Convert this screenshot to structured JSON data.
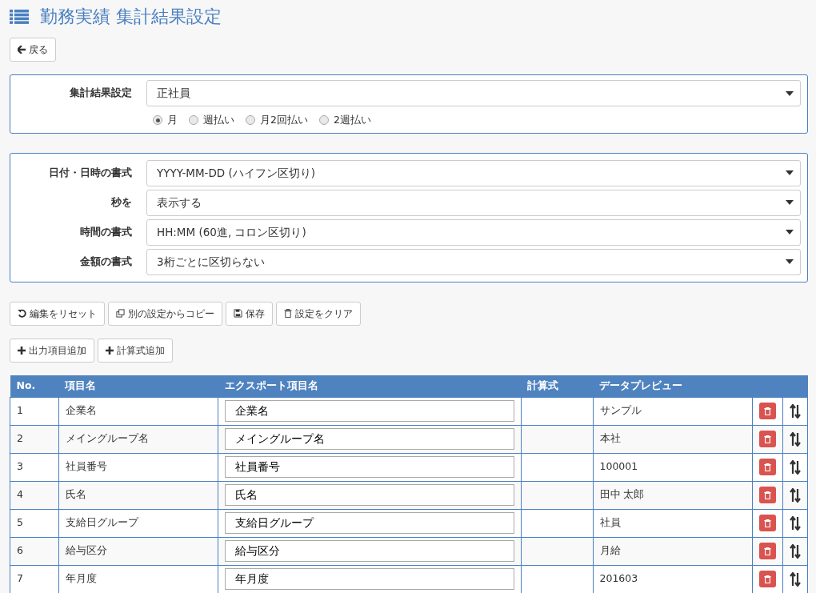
{
  "title": "勤務実績 集計結果設定",
  "back_button": "戻る",
  "summary_setting": {
    "label": "集計結果設定",
    "value": "正社員",
    "options": [
      {
        "label": "月",
        "selected": true
      },
      {
        "label": "週払い",
        "selected": false
      },
      {
        "label": "月2回払い",
        "selected": false
      },
      {
        "label": "2週払い",
        "selected": false
      }
    ]
  },
  "format_settings": [
    {
      "label": "日付・日時の書式",
      "value": "YYYY-MM-DD (ハイフン区切り)"
    },
    {
      "label": "秒を",
      "value": "表示する"
    },
    {
      "label": "時間の書式",
      "value": "HH:MM (60進, コロン区切り)"
    },
    {
      "label": "金額の書式",
      "value": "3桁ごとに区切らない"
    }
  ],
  "action_buttons": [
    {
      "kind": "reset",
      "label": "編集をリセット"
    },
    {
      "kind": "copy",
      "label": "別の設定からコピー"
    },
    {
      "kind": "save",
      "label": "保存"
    },
    {
      "kind": "clear",
      "label": "設定をクリア"
    }
  ],
  "add_buttons": [
    {
      "label": "出力項目追加"
    },
    {
      "label": "計算式追加"
    }
  ],
  "table": {
    "columns": [
      "No.",
      "項目名",
      "エクスポート項目名",
      "計算式",
      "データプレビュー"
    ],
    "rows": [
      {
        "no": "1",
        "name": "企業名",
        "export_name": "企業名",
        "preview": "サンプル"
      },
      {
        "no": "2",
        "name": "メイングループ名",
        "export_name": "メイングループ名",
        "preview": "本社"
      },
      {
        "no": "3",
        "name": "社員番号",
        "export_name": "社員番号",
        "preview": "100001"
      },
      {
        "no": "4",
        "name": "氏名",
        "export_name": "氏名",
        "preview": "田中 太郎"
      },
      {
        "no": "5",
        "name": "支給日グループ",
        "export_name": "支給日グループ",
        "preview": "社員"
      },
      {
        "no": "6",
        "name": "給与区分",
        "export_name": "給与区分",
        "preview": "月給"
      },
      {
        "no": "7",
        "name": "年月度",
        "export_name": "年月度",
        "preview": "201603"
      }
    ]
  }
}
